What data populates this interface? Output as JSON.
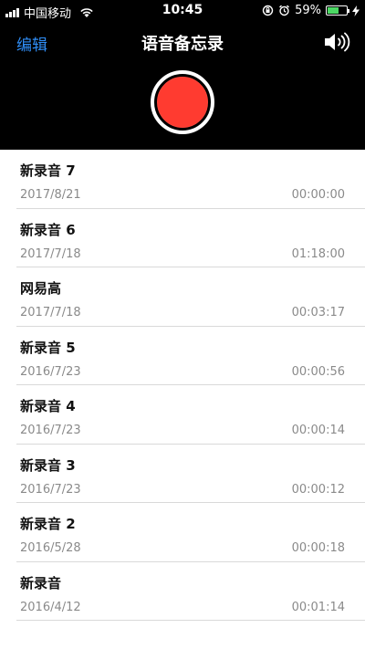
{
  "status_bar": {
    "carrier": "中国移动",
    "time": "10:45",
    "battery": "59%",
    "battery_level": 0.59
  },
  "nav": {
    "edit_label": "编辑",
    "title": "语音备忘录"
  },
  "recordings": [
    {
      "name": "新录音 7",
      "date": "2017/8/21",
      "duration": "00:00:00"
    },
    {
      "name": "新录音 6",
      "date": "2017/7/18",
      "duration": "01:18:00"
    },
    {
      "name": "网易高",
      "date": "2017/7/18",
      "duration": "00:03:17"
    },
    {
      "name": "新录音 5",
      "date": "2016/7/23",
      "duration": "00:00:56"
    },
    {
      "name": "新录音 4",
      "date": "2016/7/23",
      "duration": "00:00:14"
    },
    {
      "name": "新录音 3",
      "date": "2016/7/23",
      "duration": "00:00:12"
    },
    {
      "name": "新录音 2",
      "date": "2016/5/28",
      "duration": "00:00:18"
    },
    {
      "name": "新录音",
      "date": "2016/4/12",
      "duration": "00:01:14"
    }
  ],
  "colors": {
    "accent": "#2f8df5",
    "record": "#ff3b30",
    "battery_fill": "#4cd964"
  }
}
